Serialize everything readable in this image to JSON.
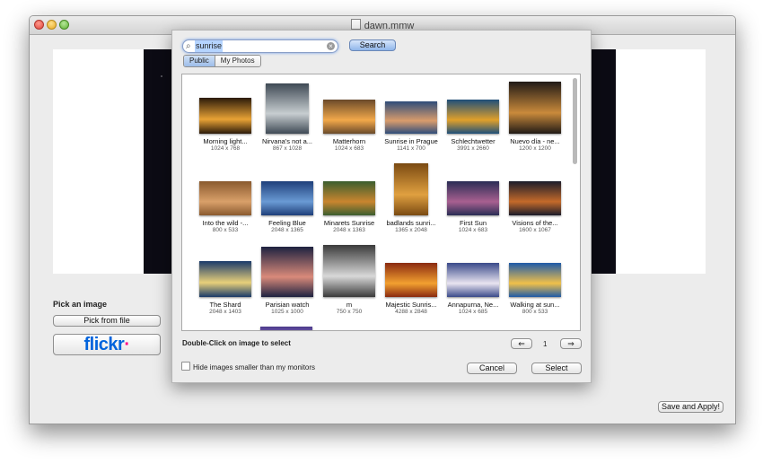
{
  "window": {
    "title": "dawn.mmw"
  },
  "left_panel": {
    "pick_label": "Pick an image",
    "pick_file_button": "Pick from file",
    "flickr_main": "flickr",
    "flickr_dot": "·"
  },
  "save_button": "Save and Apply!",
  "dialog": {
    "search_value": "sunrise",
    "search_button": "Search",
    "tabs": {
      "public": "Public",
      "my_photos": "My Photos"
    },
    "hint": "Double-Click on image to select",
    "page_number": "1",
    "prev_label": "⇐",
    "next_label": "⇒",
    "hide_small_label": "Hide images smaller than my monitors",
    "cancel_button": "Cancel",
    "select_button": "Select"
  },
  "results": [
    {
      "name": "Morning light...",
      "size": "1024 x 768",
      "colors": [
        "#2b1a0a",
        "#e8a235"
      ]
    },
    {
      "name": "Nirvana's not a...",
      "size": "867 x 1028",
      "colors": [
        "#3f4a55",
        "#c7cdd0"
      ]
    },
    {
      "name": "Matterhorn",
      "size": "1024 x 683",
      "colors": [
        "#6a4a2a",
        "#f2a84a"
      ]
    },
    {
      "name": "Sunrise in Prague",
      "size": "1141 x 700",
      "colors": [
        "#2f4d7a",
        "#d99c6c"
      ]
    },
    {
      "name": "Schlechtwetter",
      "size": "3991 x 2660",
      "colors": [
        "#1e4f7a",
        "#e0a02a"
      ]
    },
    {
      "name": "Nuevo día - ne...",
      "size": "1200 x 1200",
      "colors": [
        "#201a16",
        "#c98a3b"
      ]
    },
    {
      "name": "Into the wild -...",
      "size": "800 x 533",
      "colors": [
        "#8a5a2e",
        "#d9a06a"
      ]
    },
    {
      "name": "Feeling Blue",
      "size": "2048 x 1365",
      "colors": [
        "#1f3f7a",
        "#6a9ad4"
      ]
    },
    {
      "name": "Minarets Sunrise",
      "size": "2048 x 1363",
      "colors": [
        "#3b5e2f",
        "#c9852f"
      ]
    },
    {
      "name": "badlands sunri...",
      "size": "1365 x 2048",
      "colors": [
        "#7a4a12",
        "#e0a040"
      ]
    },
    {
      "name": "First Sun",
      "size": "1024 x 683",
      "colors": [
        "#2a2d55",
        "#a86090"
      ]
    },
    {
      "name": "Visions of the...",
      "size": "1600 x 1067",
      "colors": [
        "#1b1c2a",
        "#c46a2a"
      ]
    },
    {
      "name": "The Shard",
      "size": "2048 x 1403",
      "colors": [
        "#1a3a6a",
        "#e8d07a"
      ]
    },
    {
      "name": "Parisian watch",
      "size": "1025 x 1000",
      "colors": [
        "#1d2240",
        "#d98a7a"
      ]
    },
    {
      "name": "m",
      "size": "750 x 750",
      "colors": [
        "#3a3a3a",
        "#d8d8d8"
      ]
    },
    {
      "name": "Majestic Sunris...",
      "size": "4288 x 2848",
      "colors": [
        "#8a2a10",
        "#f2a030"
      ]
    },
    {
      "name": "Annapurna, Ne...",
      "size": "1024 x 685",
      "colors": [
        "#3a4a8a",
        "#e9e4f0"
      ]
    },
    {
      "name": "Walking at sun...",
      "size": "800 x 533",
      "colors": [
        "#1e5aa8",
        "#f0c04a"
      ]
    }
  ]
}
